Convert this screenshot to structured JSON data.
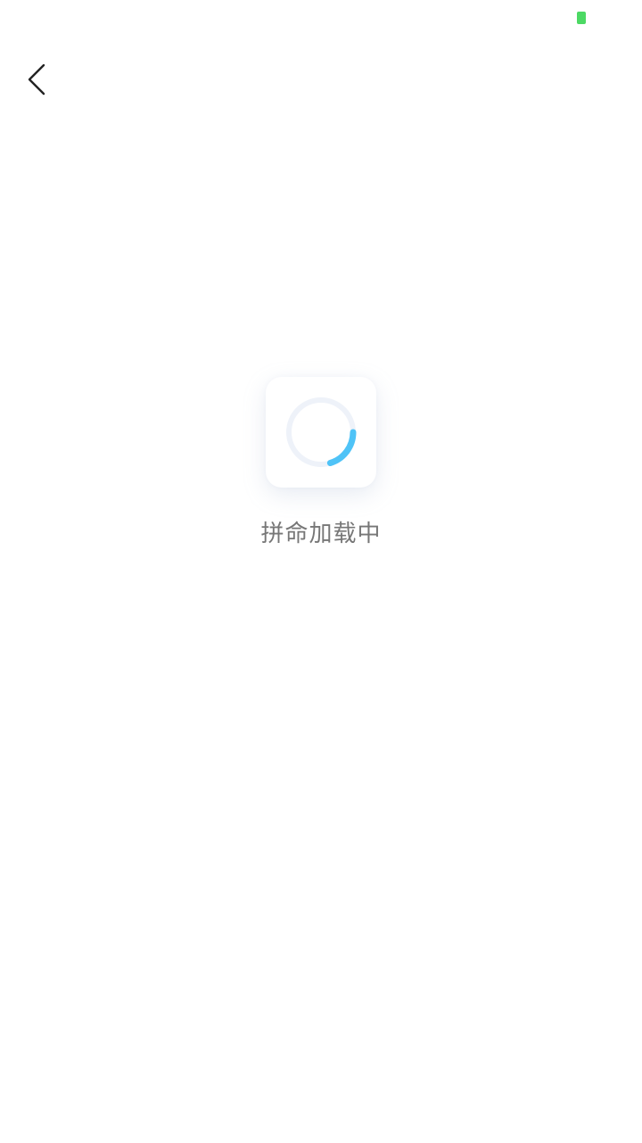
{
  "status_bar": {
    "battery_icon": "battery-icon",
    "battery_color": "#4cd964"
  },
  "nav": {
    "back_icon": "chevron-left-icon",
    "back_color": "#222222"
  },
  "loading": {
    "spinner_icon": "loading-spinner-icon",
    "track_color": "#eef2f9",
    "arc_color": "#4fc3f7",
    "text": "拼命加载中",
    "text_color": "#777777"
  }
}
